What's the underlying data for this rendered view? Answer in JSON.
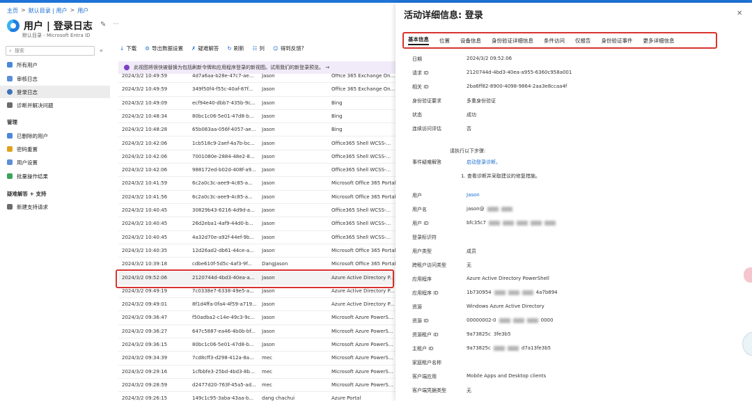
{
  "breadcrumb": [
    "主页",
    ">",
    "默认目录 | 用户",
    ">",
    "用户"
  ],
  "page": {
    "title": "用户 | 登录日志",
    "subtitle": "默认目录 - Microsoft Entra ID"
  },
  "sidebar": {
    "search_placeholder": "搜索",
    "items": [
      "所有用户",
      "审核日志",
      "登录日志",
      "诊断并解决问题"
    ],
    "manage_header": "管理",
    "manage_items": [
      "已删除的用户",
      "密码重置",
      "用户设置",
      "批量操作结果"
    ],
    "support_header": "疑难解答 + 支持",
    "support_items": [
      "新建支持请求"
    ]
  },
  "toolbar": [
    "下载",
    "导出数据设置",
    "疑难解答",
    "刷新",
    "列",
    "得到反馈?"
  ],
  "banner": "此视图将很快被替换为包括刷新令牌和应用程序登录的新视图。试用我们的新登录预览。 →",
  "rows": [
    [
      "2024/3/2 10:49:59",
      "4d7a6aa-b28e-47c7-ae...",
      "Jason",
      "Office 365 Exchange On..."
    ],
    [
      "2024/3/2 10:49:59",
      "349f50f4-f55c-40af-87f...",
      "Jason",
      "Office 365 Exchange On..."
    ],
    [
      "2024/3/2 10:49:09",
      "ecf94e40-dbb7-435b-9c...",
      "Jason",
      "Bing"
    ],
    [
      "2024/3/2 10:48:34",
      "80bc1c06-5e01-47d8-b...",
      "Jason",
      "Bing"
    ],
    [
      "2024/3/2 10:48:28",
      "65b083aa-056f-4057-ae...",
      "Jason",
      "Bing"
    ],
    [
      "2024/3/2 10:42:06",
      "1cb518c9-2aef-4a7b-bc...",
      "Jason",
      "Office365 Shell WCSS-..."
    ],
    [
      "2024/3/2 10:42:06",
      "7001080e-2884-48e2-8...",
      "Jason",
      "Office365 Shell WCSS-..."
    ],
    [
      "2024/3/2 10:42:06",
      "988172ed-b02d-408f-a9...",
      "Jason",
      "Office365 Shell WCSS-..."
    ],
    [
      "2024/3/2 10:41:59",
      "6c2a0c3c-aee9-4c85-a...",
      "Jason",
      "Microsoft Office 365 Portal"
    ],
    [
      "2024/3/2 10:41:56",
      "6c2a0c3c-aee9-4c85-a...",
      "Jason",
      "Microsoft Office 365 Portal"
    ],
    [
      "2024/3/2 10:40:45",
      "30829b43-6216-4d9d-a...",
      "Jason",
      "Office365 Shell WCSS-..."
    ],
    [
      "2024/3/2 10:40:45",
      "26d2eba1-4af9-44d0-b...",
      "Jason",
      "Office365 Shell WCSS-..."
    ],
    [
      "2024/3/2 10:40:45",
      "4a32d70e-a92f-44ef-9b...",
      "Jason",
      "Office365 Shell WCSS-..."
    ],
    [
      "2024/3/2 10:40:35",
      "12d26ad2-db61-44ce-a...",
      "Jason",
      "Microsoft Office 365 Portal"
    ],
    [
      "2024/3/2 10:39:18",
      "cdbe610f-5d5c-4af3-9f...",
      "DangJason",
      "Microsoft Office 365 Portal"
    ],
    [
      "2024/3/2 09:52:06",
      "2120744d-4bd3-40ea-a...",
      "Jason",
      "Azure Active Directory P..."
    ],
    [
      "2024/3/2 09:49:19",
      "7c0338e7-6338-49e5-a...",
      "Jason",
      "Azure Active Directory P..."
    ],
    [
      "2024/3/2 09:49:01",
      "8f1d4ffa-0fa4-4f59-a719...",
      "Jason",
      "Azure Active Directory P..."
    ],
    [
      "2024/3/2 09:36:47",
      "f50adba2-c14e-49c3-9c...",
      "Jason",
      "Microsoft Azure PowerS..."
    ],
    [
      "2024/3/2 09:36:27",
      "647c5887-ea46-4b0b-bf...",
      "Jason",
      "Microsoft Azure PowerS..."
    ],
    [
      "2024/3/2 09:36:15",
      "80bc1c06-5e01-47d8-b...",
      "Jason",
      "Microsoft Azure PowerS..."
    ],
    [
      "2024/3/2 09:34:39",
      "7cd8cff3-d298-412a-8a...",
      "mec",
      "Microsoft Azure PowerS..."
    ],
    [
      "2024/3/2 09:29:16",
      "1cfbbfe3-25bd-4bd3-8b...",
      "mec",
      "Microsoft Azure PowerS..."
    ],
    [
      "2024/3/2 09:28:59",
      "d2477d20-763f-45a5-ad...",
      "mec",
      "Microsoft Azure PowerS..."
    ],
    [
      "2024/3/2 09:26:15",
      "149c1c95-3aba-43aa-b...",
      "dang chachui",
      "Azure Portal"
    ]
  ],
  "panel": {
    "title": "活动详细信息: 登录",
    "tabs": [
      "基本信息",
      "位置",
      "设备信息",
      "身份验证详细信息",
      "条件访问",
      "仅报告",
      "身份验证事件",
      "更多详细信息"
    ],
    "fields": [
      [
        "日期",
        "2024/3/2 09:52:06"
      ],
      [
        "请求 ID",
        "2120744d-4bd3-40ea-a955-6360c958a001"
      ],
      [
        "相关 ID",
        "2ba6ff82-8900-4098-9864-2aa3e8ccaa4f"
      ],
      [
        "身份验证要求",
        "多重身份验证"
      ],
      [
        "状态",
        "成功"
      ],
      [
        "连续访问评估",
        "否"
      ]
    ],
    "troubleshoot": {
      "label": "事件疑难解答",
      "intro": "请执行以下步骤:",
      "link": "启动登录诊断。",
      "step": "1. 查看诊断并采取建议的修复措施。"
    },
    "details": [
      [
        "用户",
        "Jason"
      ],
      [
        "用户名",
        "jason@"
      ],
      [
        "用户 ID",
        "bfc35c7"
      ],
      [
        "登录标识符",
        ""
      ],
      [
        "用户类型",
        "成员"
      ],
      [
        "跨租户访问类型",
        "无"
      ],
      [
        "应用程序",
        "Azure Active Directory PowerShell"
      ],
      [
        "应用程序 ID",
        "1b730954"
      ],
      [
        "资源",
        "Windows Azure Active Directory"
      ],
      [
        "资源 ID",
        "00000002-0"
      ],
      [
        "资源租户 ID",
        "9a73825c"
      ],
      [
        "主租户 ID",
        "9a73825c"
      ],
      [
        "家庭租户名称",
        ""
      ],
      [
        "客户端应用",
        "Mobile Apps and Desktop clients"
      ],
      [
        "客户端凭据类型",
        "无"
      ]
    ],
    "detail_tails": {
      "7": "4a7b894",
      "9": "0000",
      "10": "3fe3b5",
      "11": "d7a13fe3b5"
    }
  }
}
